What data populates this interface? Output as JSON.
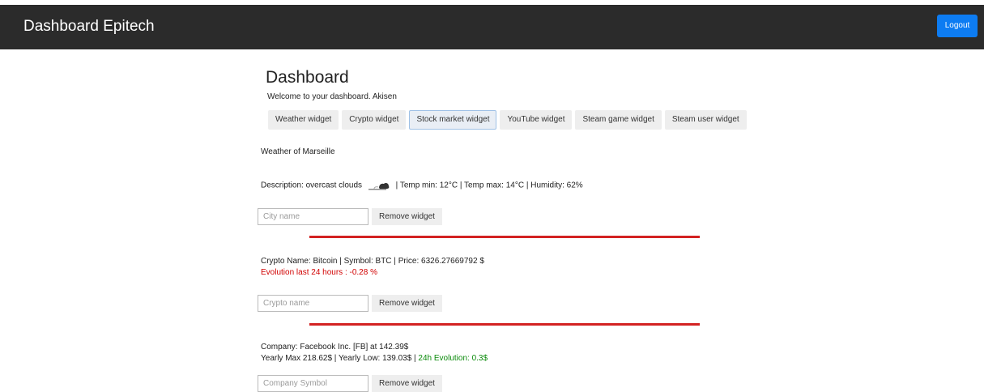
{
  "navbar": {
    "brand": "Dashboard Epitech",
    "logout_label": "Logout"
  },
  "page": {
    "title": "Dashboard",
    "welcome": "Welcome to your dashboard. Akisen"
  },
  "tabs": [
    {
      "label": "Weather widget",
      "active": false
    },
    {
      "label": "Crypto widget",
      "active": false
    },
    {
      "label": "Stock market widget",
      "active": true
    },
    {
      "label": "YouTube widget",
      "active": false
    },
    {
      "label": "Steam game widget",
      "active": false
    },
    {
      "label": "Steam user widget",
      "active": false
    }
  ],
  "weather": {
    "heading": "Weather of Marseille",
    "description": "Description: overcast clouds",
    "details": "| Temp min: 12°C | Temp max: 14°C | Humidity: 62%",
    "icon": "overcast-clouds-icon",
    "input_placeholder": "City name",
    "remove_label": "Remove widget"
  },
  "crypto": {
    "info": "Crypto Name: Bitcoin | Symbol: BTC | Price: 6326.27669792 $",
    "evolution": "Evolution last 24 hours : -0.28 %",
    "input_placeholder": "Crypto name",
    "remove_label": "Remove widget"
  },
  "stock": {
    "company": "Company: Facebook Inc. [FB] at 142.39$",
    "yearly": "Yearly Max 218.62$ | Yearly Low: 139.03$ |",
    "evolution": "24h Evolution: 0.3$",
    "input_placeholder": "Company Symbol",
    "remove_label": "Remove widget"
  },
  "colors": {
    "navbar": "#2b2b2b",
    "logout": "#0d7cf2",
    "divider": "#d32222",
    "negative": "#d10000",
    "positive": "#0a8a0a"
  }
}
